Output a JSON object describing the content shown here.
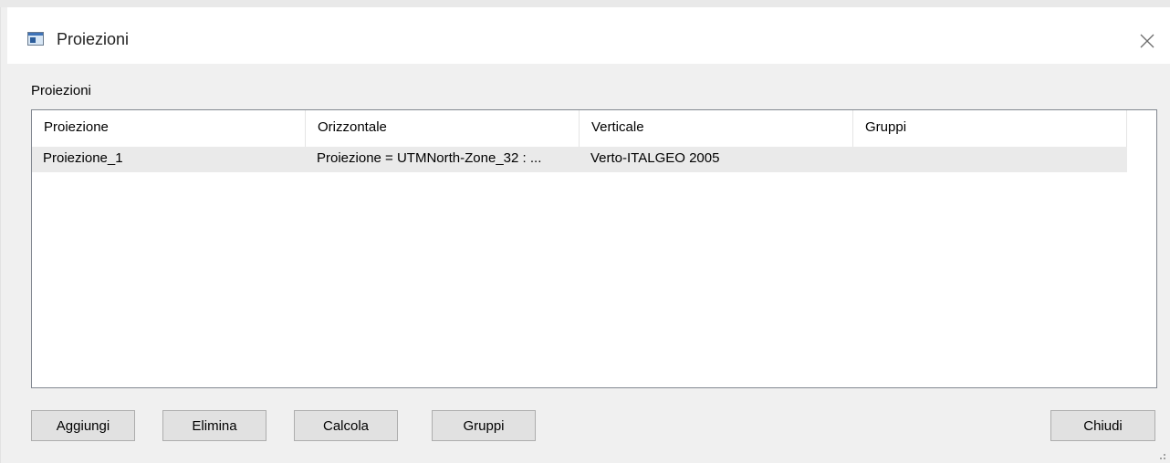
{
  "window": {
    "title": "Proiezioni",
    "icons": {
      "app": "window-icon",
      "close": "close-icon"
    }
  },
  "group_label": "Proiezioni",
  "table": {
    "columns": [
      "Proiezione",
      "Orizzontale",
      "Verticale",
      "Gruppi"
    ],
    "rows": [
      [
        "Proiezione_1",
        "Proiezione = UTMNorth-Zone_32 : ...",
        "Verto-ITALGEO 2005",
        ""
      ]
    ]
  },
  "buttons": {
    "add": "Aggiungi",
    "delete": "Elimina",
    "calculate": "Calcola",
    "groups": "Gruppi",
    "close": "Chiudi"
  },
  "colors": {
    "dialog_bg": "#f0f0f0",
    "selected_row": "#eaeaea",
    "button_bg": "#e1e1e1",
    "border": "#828790"
  }
}
